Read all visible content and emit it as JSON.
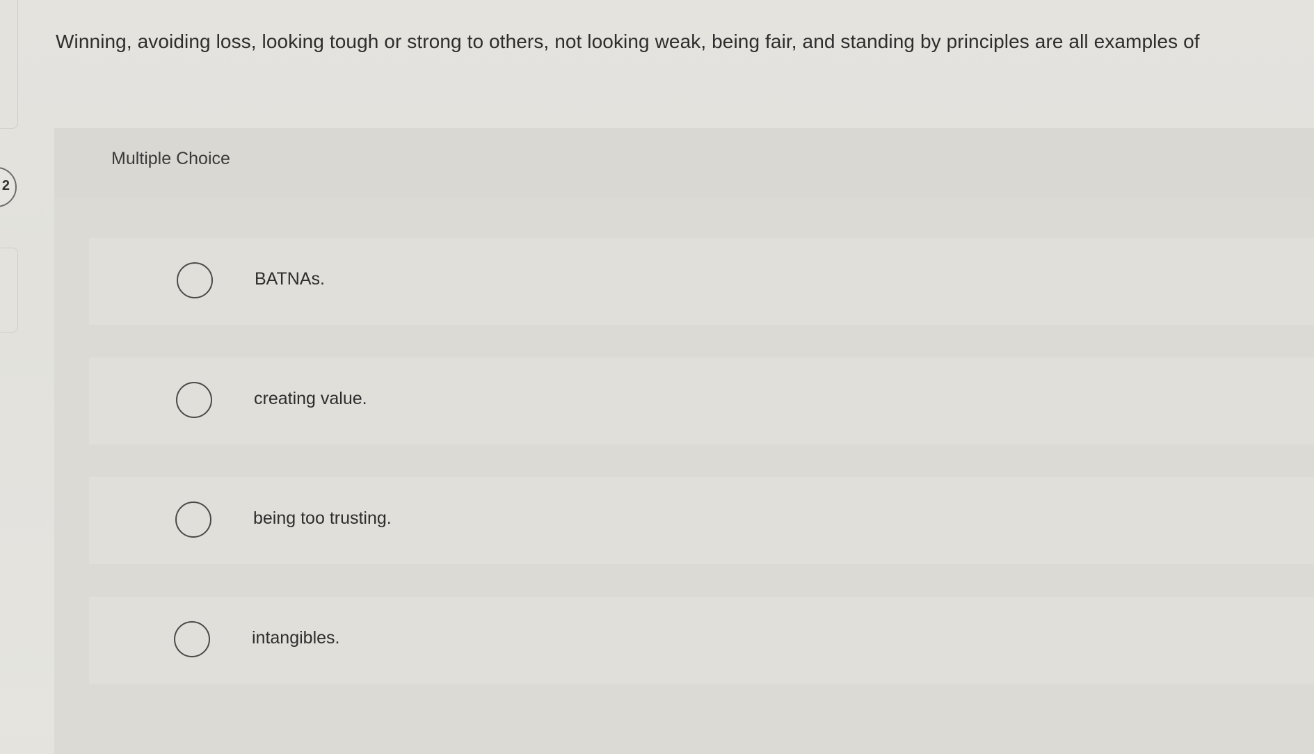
{
  "question": {
    "number": "2",
    "text": "Winning, avoiding loss, looking tough or strong to others, not looking weak, being fair, and standing by principles are all examples of"
  },
  "answer_panel": {
    "type_label": "Multiple Choice",
    "options": [
      {
        "label": "BATNAs."
      },
      {
        "label": "creating value."
      },
      {
        "label": "being too trusting."
      },
      {
        "label": "intangibles."
      }
    ]
  }
}
